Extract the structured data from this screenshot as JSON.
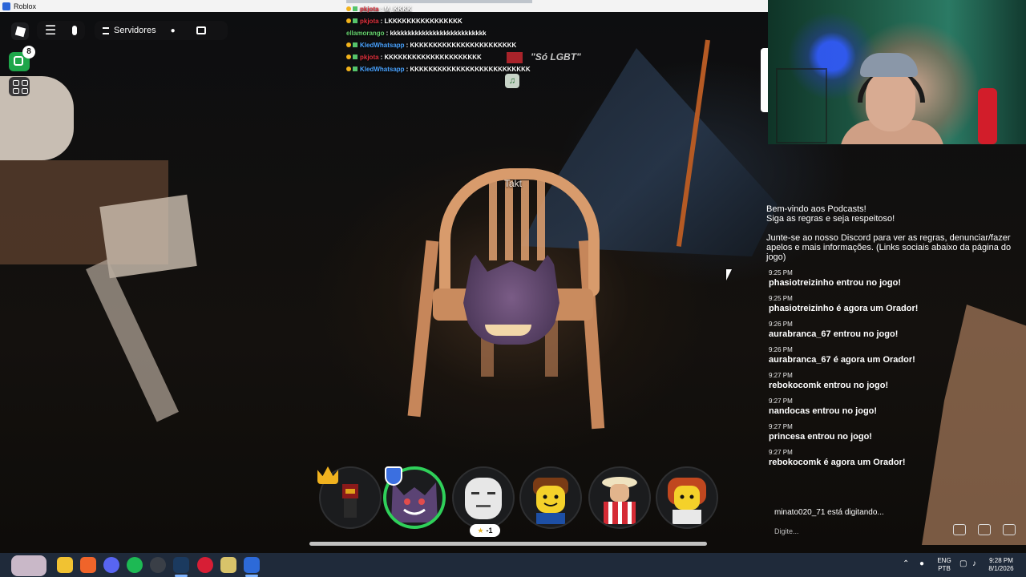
{
  "window": {
    "title": "Roblox"
  },
  "topbar": {
    "menu_icon": "hamburger-icon",
    "mic_icon": "microphone-icon",
    "servers_label": "Servidores",
    "notification_count": "8"
  },
  "scene": {
    "chair_player_name": "Takt",
    "sign_text": "\"Só LGBT\""
  },
  "stream_chat": [
    {
      "user": "pkjota",
      "user_color": "#e0303c",
      "text": "M, KKKK"
    },
    {
      "user": "pkjota",
      "user_color": "#e0303c",
      "text": "LKKKKKKKKKKKKKKKK"
    },
    {
      "user": "ellamorango",
      "user_color": "#66d36e",
      "text": "kkkkkkkkkkkkkkkkkkkkkkkkkkk"
    },
    {
      "user": "KledWhatsapp",
      "user_color": "#4aa3ff",
      "text": "KKKKKKKKKKKKKKKKKKKKKKK"
    },
    {
      "user": "pkjota",
      "user_color": "#e0303c",
      "text": "KKKKKKKKKKKKKKKKKKKKK"
    },
    {
      "user": "KledWhatsapp",
      "user_color": "#4aa3ff",
      "text": "KKKKKKKKKKKKKKKKKKKKKKKKKK"
    }
  ],
  "game_chat": {
    "welcome_line1": "Bem-vindo aos Podcasts!",
    "welcome_line2": "Siga as regras e seja respeitoso!",
    "welcome_line3": "Junte-se ao nosso Discord para ver as regras, denunciar/fazer apelos e mais informações. (Links sociais abaixo da página do jogo)",
    "messages": [
      {
        "time": "9:25 PM",
        "text": "phasiotreizinho entrou no jogo!"
      },
      {
        "time": "9:25 PM",
        "text": "phasiotreizinho é agora um Orador!"
      },
      {
        "time": "9:26 PM",
        "text": "aurabranca_67 entrou no jogo!"
      },
      {
        "time": "9:26 PM",
        "text": "aurabranca_67 é agora um Orador!"
      },
      {
        "time": "9:27 PM",
        "text": "rebokocomk entrou no jogo!"
      },
      {
        "time": "9:27 PM",
        "text": "nandocas entrou no jogo!"
      },
      {
        "time": "9:27 PM",
        "text": "princesa entrou no jogo!"
      },
      {
        "time": "9:27 PM",
        "text": "rebokocomk é agora um Orador!"
      }
    ],
    "typing_text": "minato020_71 está digitando...",
    "input_placeholder": "Digite..."
  },
  "speakers": {
    "star_badge": "-1",
    "avatars": [
      "crowned-speaker",
      "gengar-speaker",
      "bald-speaker",
      "brown-hair-speaker",
      "hat-speaker",
      "red-hair-speaker"
    ]
  },
  "taskbar": {
    "lang_top": "ENG",
    "lang_bottom": "PTB",
    "clock_time": "9:28 PM",
    "clock_date": "8/1/2026",
    "colors": {
      "brave": "#f0642a",
      "discord": "#5865f2",
      "spotify": "#1db954",
      "steam": "#1b3a5f"
    }
  }
}
